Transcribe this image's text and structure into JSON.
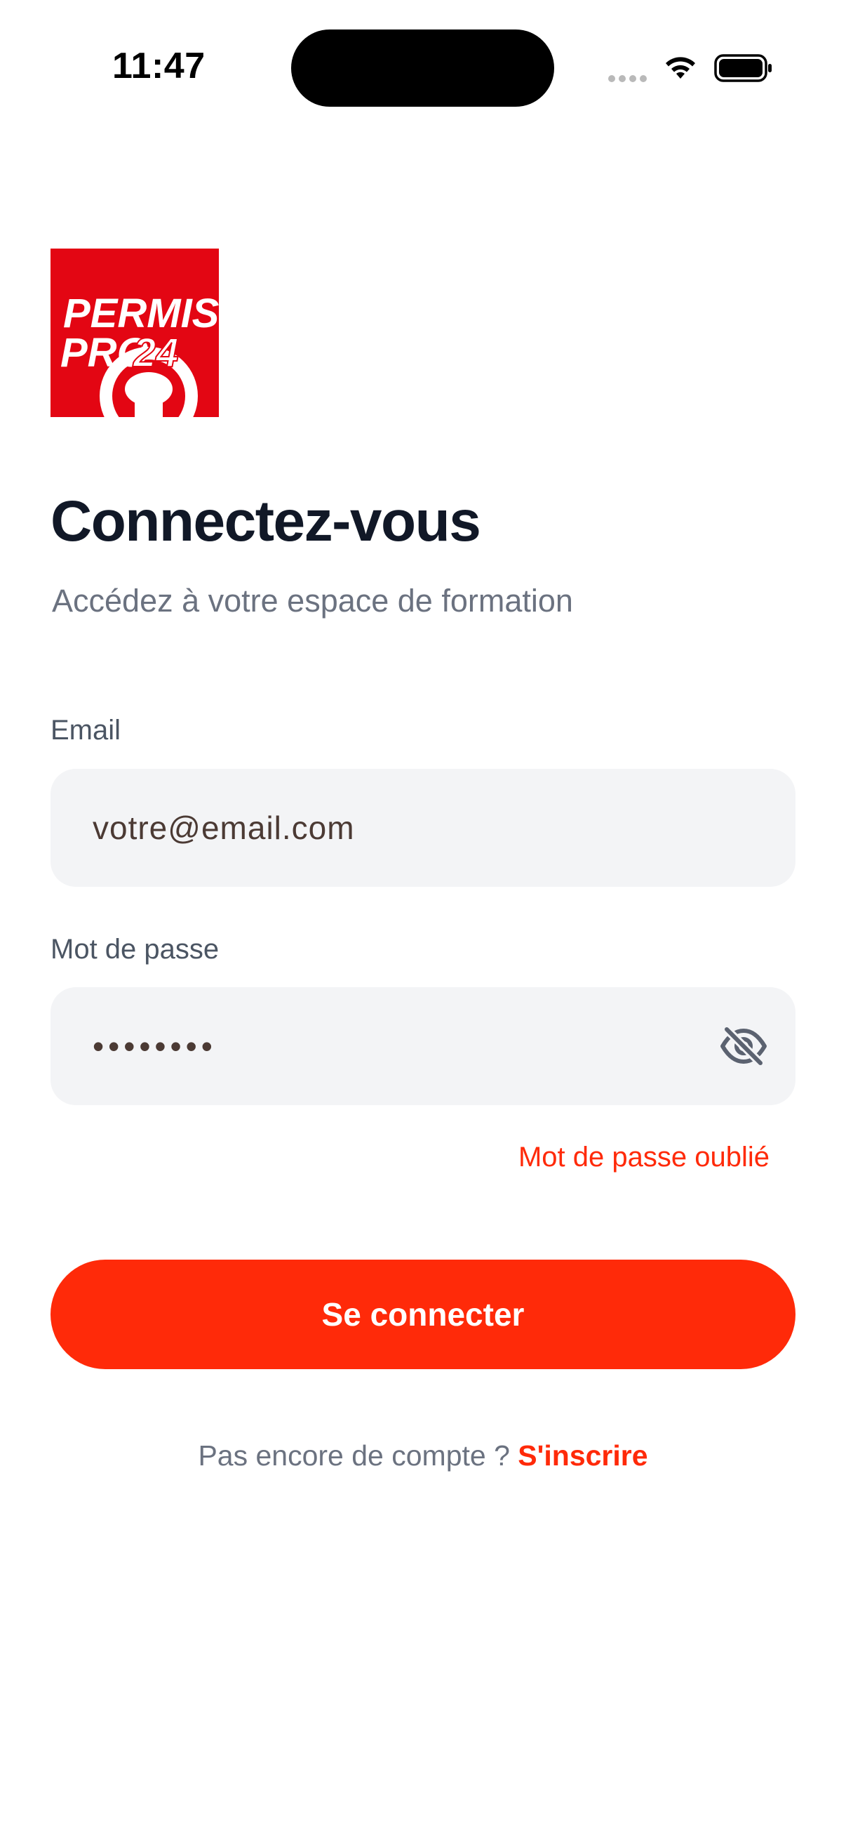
{
  "status_bar": {
    "time": "11:47"
  },
  "logo": {
    "line1": "PERMIS",
    "line2": "PRO",
    "number": "24"
  },
  "header": {
    "title": "Connectez-vous",
    "subtitle": "Accédez à votre espace de formation"
  },
  "form": {
    "email_label": "Email",
    "email_placeholder": "votre@email.com",
    "password_label": "Mot de passe",
    "password_value": "••••••••",
    "forgot_password": "Mot de passe oublié",
    "submit_label": "Se connecter"
  },
  "signup": {
    "prompt": "Pas encore de compte ? ",
    "link": "S'inscrire"
  },
  "colors": {
    "accent": "#ff2a09",
    "brand_red": "#e30613",
    "title": "#111827",
    "muted": "#6b7280",
    "field_background": "#f3f4f6"
  },
  "icons": {
    "status_signal": "cellular-signal-icon",
    "status_wifi": "wifi-icon",
    "status_battery": "battery-icon",
    "password_toggle": "eye-off-icon"
  }
}
